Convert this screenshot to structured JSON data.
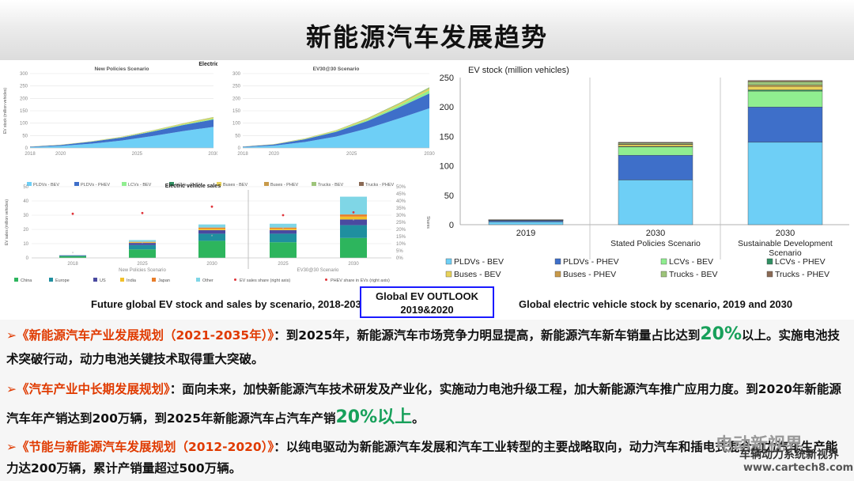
{
  "slide": {
    "title": "新能源汽车发展趋势",
    "outlook_box": [
      "Global EV OUTLOOK",
      "2019&2020"
    ],
    "caption_left": "Future global EV stock and sales by scenario, 2018-2030",
    "caption_right": "Global electric vehicle stock by scenario, 2019 and 2030",
    "watermark_name": "电动新视界",
    "watermark_site": "www.cartech8.com",
    "watermark_cn": "车辆动力系统新视界"
  },
  "paragraphs": [
    {
      "marker": "➢",
      "policy": "《新能源汽车产业发展规划（2021-2035年）》",
      "pre": "：到2025年，新能源汽车市场竞争力明显提高，新能源汽车新车销量占比达到",
      "big": "20%",
      "post": "以上。实施电池技术突破行动，动力电池关键技术取得重大突破。"
    },
    {
      "marker": "➢",
      "policy": "《汽车产业中长期发展规划》",
      "pre": "：面向未来，加快新能源汽车技术研发及产业化，实施动力电池升级工程，加大新能源汽车推广应用力度。到2020年新能源汽车年产销达到200万辆，到2025年新能源汽车占汽车产销",
      "big": "20%以上",
      "post": "。"
    },
    {
      "marker": "➢",
      "policy": "《节能与新能源汽车发展规划（2012-2020）》",
      "pre": "：以纯电驱动为新能源汽车发展和汽车工业转型的主要战略取向，",
      "big": "",
      "post": "动力汽车和插电式混合动力汽车生产能力达200万辆，累计产销量超过500万辆。"
    }
  ],
  "colors": {
    "pldv_bev": "#6ecff6",
    "pldv_phev": "#3e6fc9",
    "lcv_bev": "#90ee90",
    "lcv_phev": "#2f8f62",
    "bus_bev": "#e8d25a",
    "bus_phev": "#c89a4a",
    "truck_bev": "#9dc47a",
    "truck_phev": "#8a6a55",
    "china": "#2db55d",
    "europe": "#1f8f9f",
    "us": "#4a4aa0",
    "india": "#f2c029",
    "japan": "#e87d2a",
    "other": "#7fd6e6",
    "share": "#e0343a"
  },
  "chart_data": [
    {
      "type": "area",
      "title": "Electric vehicle stock",
      "subtitle": "New Policies Scenario",
      "ylabel": "EV stock (million vehicles)",
      "x": [
        2018,
        2020,
        2022,
        2024,
        2026,
        2028,
        2030
      ],
      "x_tick_labels": [
        "2018",
        "2020",
        "2025",
        "2030"
      ],
      "y_ticks": [
        0,
        50,
        100,
        150,
        200,
        250,
        300
      ],
      "ylim": [
        0,
        300
      ],
      "series": [
        {
          "name": "PLDVs - BEV",
          "values": [
            3,
            8,
            17,
            30,
            48,
            68,
            85
          ]
        },
        {
          "name": "PLDVs - PHEV",
          "values": [
            2,
            4,
            8,
            12,
            18,
            24,
            30
          ]
        },
        {
          "name": "LCVs - BEV",
          "values": [
            0.2,
            0.4,
            0.8,
            1.2,
            2,
            3,
            4
          ]
        },
        {
          "name": "Buses - BEV",
          "values": [
            0.5,
            0.7,
            1,
            1.5,
            2,
            3,
            4
          ]
        },
        {
          "name": "Trucks - BEV",
          "values": [
            0.1,
            0.2,
            0.4,
            0.7,
            1,
            1.5,
            2
          ]
        }
      ]
    },
    {
      "type": "area",
      "subtitle": "EV30@30 Scenario",
      "x": [
        2018,
        2020,
        2022,
        2024,
        2026,
        2028,
        2030
      ],
      "x_tick_labels": [
        "2018",
        "2020",
        "2025",
        "2030"
      ],
      "y_ticks": [
        0,
        50,
        100,
        150,
        200,
        250,
        300
      ],
      "ylim": [
        0,
        300
      ],
      "series": [
        {
          "name": "PLDVs - BEV",
          "values": [
            3,
            9,
            24,
            46,
            78,
            118,
            160
          ]
        },
        {
          "name": "PLDVs - PHEV",
          "values": [
            2,
            5,
            11,
            19,
            30,
            44,
            60
          ]
        },
        {
          "name": "LCVs - BEV",
          "values": [
            0.2,
            0.5,
            1.5,
            3,
            5,
            8,
            12
          ]
        },
        {
          "name": "Buses - BEV",
          "values": [
            0.5,
            0.8,
            1.5,
            2.5,
            4,
            5.5,
            7
          ]
        },
        {
          "name": "Trucks - BEV",
          "values": [
            0.1,
            0.3,
            0.8,
            1.5,
            2.5,
            4,
            6
          ]
        }
      ],
      "legend": [
        "PLDVs - BEV",
        "PLDVs - PHEV",
        "LCVs - BEV",
        "LCVs - PHEV",
        "Buses - BEV",
        "Buses - PHEV",
        "Trucks - BEV",
        "Trucks - PHEV"
      ]
    },
    {
      "type": "bar",
      "title": "Electric vehicle sales",
      "ylabel": "EV sales (million vehicles)",
      "y2label": "Shares",
      "categories": [
        "2018",
        "2025",
        "2030",
        "2025",
        "2030"
      ],
      "group_labels": [
        "New Policies Scenario",
        "EV30@30 Scenario"
      ],
      "y_ticks": [
        0,
        10,
        20,
        30,
        40,
        50
      ],
      "y2_ticks": [
        "0%",
        "5%",
        "10%",
        "15%",
        "20%",
        "25%",
        "30%",
        "35%",
        "40%",
        "45%",
        "50%"
      ],
      "ylim": [
        0,
        50
      ],
      "series": [
        {
          "name": "China",
          "values": [
            1.1,
            6,
            12,
            11,
            14
          ]
        },
        {
          "name": "Europe",
          "values": [
            0.4,
            3,
            5,
            6,
            9
          ]
        },
        {
          "name": "US",
          "values": [
            0.3,
            1.5,
            2.5,
            2.5,
            4
          ]
        },
        {
          "name": "India",
          "values": [
            0,
            0.5,
            1,
            1,
            2
          ]
        },
        {
          "name": "Japan",
          "values": [
            0.05,
            0.3,
            0.8,
            0.8,
            1.5
          ]
        },
        {
          "name": "Other",
          "values": [
            0.15,
            1.2,
            2.2,
            2.7,
            12.5
          ]
        }
      ],
      "share_points": [
        31,
        31.5,
        36,
        30,
        32
      ],
      "phev_share_points": [
        3,
        10,
        15,
        20,
        26
      ],
      "legend": [
        "China",
        "Europe",
        "US",
        "India",
        "Japan",
        "Other",
        "EV sales share (right axis)",
        "PHEV share in EVs (right axis)"
      ]
    },
    {
      "type": "bar",
      "ylabel": "EV stock (million vehicles)",
      "categories": [
        "2019",
        "2030",
        "2030"
      ],
      "category_sublabels": [
        "",
        "Stated Policies Scenario",
        "Sustainable Development Scenario"
      ],
      "y_ticks": [
        0,
        50,
        100,
        150,
        200,
        250
      ],
      "ylim": [
        0,
        250
      ],
      "series": [
        {
          "name": "PLDVs - BEV",
          "values": [
            4.8,
            76,
            140
          ]
        },
        {
          "name": "PLDVs - PHEV",
          "values": [
            2.4,
            42,
            60
          ]
        },
        {
          "name": "LCVs - BEV",
          "values": [
            0.4,
            14,
            27
          ]
        },
        {
          "name": "LCVs - PHEV",
          "values": [
            0.1,
            1,
            2
          ]
        },
        {
          "name": "Buses - BEV",
          "values": [
            0.5,
            3,
            6
          ]
        },
        {
          "name": "Buses - PHEV",
          "values": [
            0.1,
            1,
            2
          ]
        },
        {
          "name": "Trucks - BEV",
          "values": [
            0.1,
            2,
            6
          ]
        },
        {
          "name": "Trucks - PHEV",
          "values": [
            0.1,
            1,
            2
          ]
        }
      ],
      "legend": [
        "PLDVs - BEV",
        "PLDVs - PHEV",
        "LCVs - BEV",
        "LCVs - PHEV",
        "Buses - BEV",
        "Buses - PHEV",
        "Trucks - BEV",
        "Trucks - PHEV"
      ]
    }
  ]
}
